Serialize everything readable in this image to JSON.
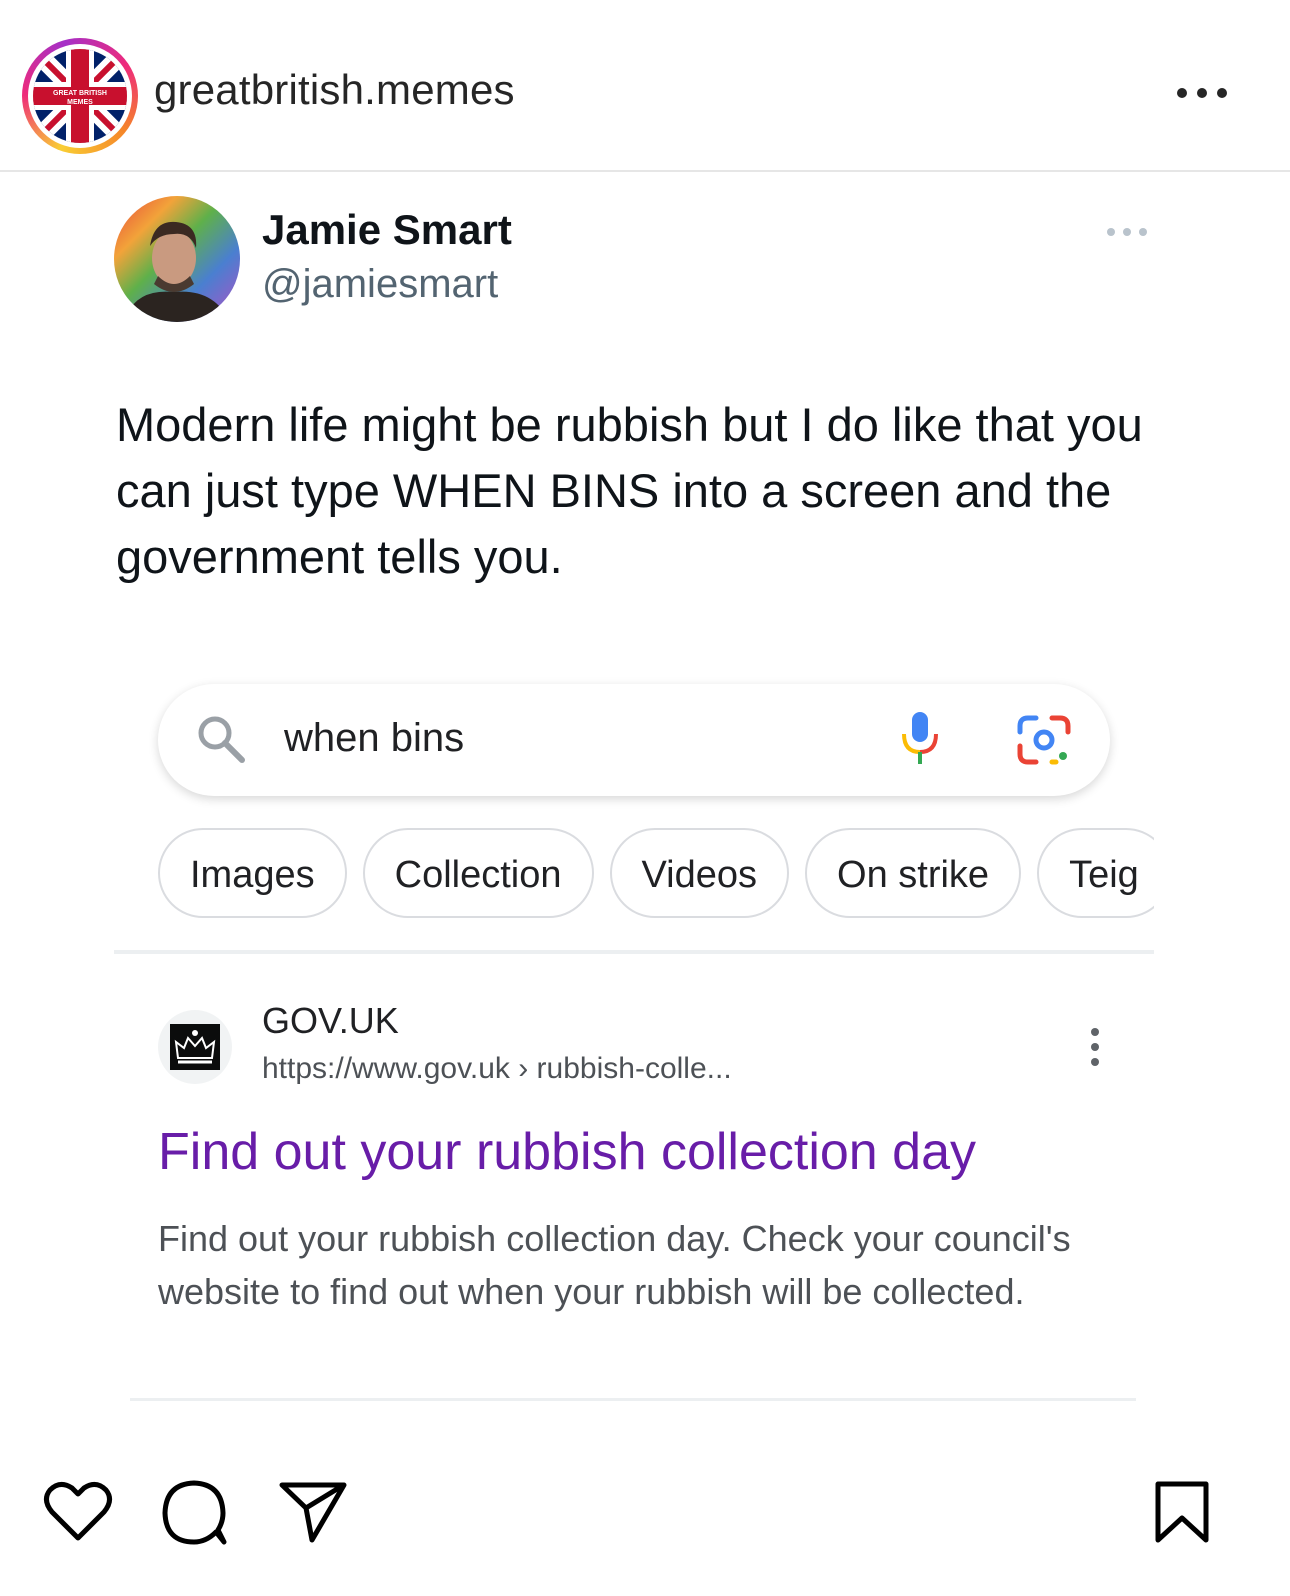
{
  "post": {
    "account_handle": "greatbritish.memes",
    "avatar_text": "GREAT BRITISH MEMES",
    "more_icon": "more-horizontal-icon"
  },
  "tweet": {
    "author_name": "Jamie Smart",
    "author_handle": "@jamiesmart",
    "text": "Modern life might be rubbish but I do like that you can just type WHEN BINS into a screen and the government tells you."
  },
  "search": {
    "query": "when bins",
    "chips": [
      "Images",
      "Collection",
      "Videos",
      "On strike",
      "Teig"
    ]
  },
  "result": {
    "site_name": "GOV.UK",
    "url": "https://www.gov.uk",
    "url_path": "› rubbish-colle...",
    "title": "Find out your rubbish collection day",
    "snippet": "Find out your rubbish collection day. Check your council's website to find out when your rubbish will be collected."
  },
  "actions": {
    "icons": [
      "heart-icon",
      "comment-icon",
      "share-icon",
      "bookmark-icon"
    ]
  },
  "colors": {
    "result_title": "#681da8",
    "handle_gray": "#536471",
    "google_blue": "#4285f4",
    "google_red": "#ea4335",
    "google_yellow": "#fbbc05",
    "google_green": "#34a853"
  }
}
